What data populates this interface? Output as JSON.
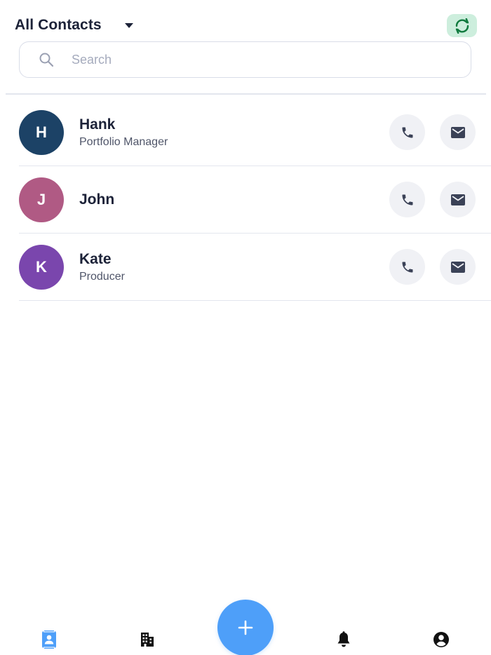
{
  "header": {
    "title": "All Contacts",
    "dropdown_icon": "caret-down-icon",
    "sync_icon": "sync-icon",
    "sync_bg_color": "#cdeedd",
    "sync_icon_color": "#0f7a3e"
  },
  "search": {
    "placeholder": "Search",
    "value": "",
    "icon": "search-icon"
  },
  "contacts": [
    {
      "initial": "H",
      "name": "Hank",
      "role": "Portfolio Manager",
      "avatar_color": "#1c4266"
    },
    {
      "initial": "J",
      "name": "John",
      "role": "",
      "avatar_color": "#b05a84"
    },
    {
      "initial": "K",
      "name": "Kate",
      "role": "Producer",
      "avatar_color": "#7a46ad"
    }
  ],
  "contact_actions": {
    "call_icon": "phone-icon",
    "email_icon": "mail-icon",
    "button_bg": "#f0f1f5"
  },
  "bottom_nav": {
    "items": [
      {
        "icon": "contacts-icon",
        "active": true
      },
      {
        "icon": "building-icon",
        "active": false
      },
      {
        "icon": "bell-icon",
        "active": false
      },
      {
        "icon": "account-icon",
        "active": false
      }
    ],
    "fab_icon": "plus-icon",
    "fab_label": "+",
    "accent": "#4e9ff9"
  }
}
